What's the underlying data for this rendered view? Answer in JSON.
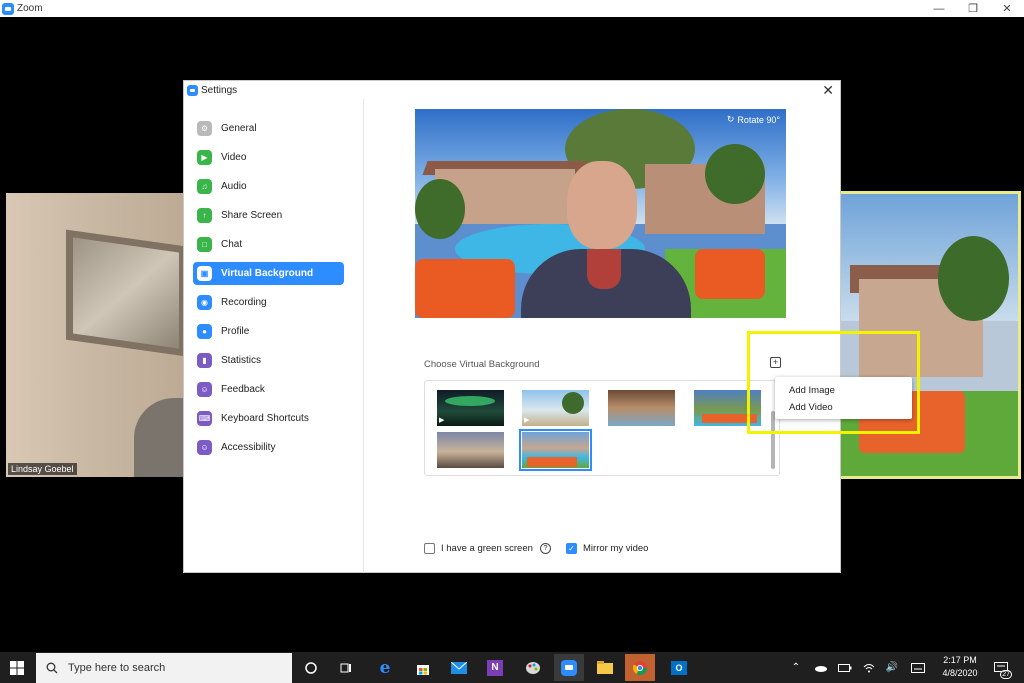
{
  "zoom_window": {
    "title": "Zoom",
    "controls": [
      "minimize",
      "restore",
      "close"
    ]
  },
  "participants": [
    {
      "name": "Lindsay Goebel"
    }
  ],
  "settings": {
    "title": "Settings",
    "close_glyph": "✕",
    "nav": [
      {
        "label": "General",
        "icon": "gear-icon",
        "color": "#b9b9b9"
      },
      {
        "label": "Video",
        "icon": "video-icon",
        "color": "#39b54a"
      },
      {
        "label": "Audio",
        "icon": "headphones-icon",
        "color": "#39b54a"
      },
      {
        "label": "Share Screen",
        "icon": "share-screen-icon",
        "color": "#39b54a"
      },
      {
        "label": "Chat",
        "icon": "chat-icon",
        "color": "#39b54a"
      },
      {
        "label": "Virtual Background",
        "icon": "virtual-background-icon",
        "color": "#2d8cff",
        "active": true
      },
      {
        "label": "Recording",
        "icon": "recording-icon",
        "color": "#2d8cff"
      },
      {
        "label": "Profile",
        "icon": "profile-icon",
        "color": "#2d8cff"
      },
      {
        "label": "Statistics",
        "icon": "statistics-icon",
        "color": "#7c5cc4"
      },
      {
        "label": "Feedback",
        "icon": "feedback-icon",
        "color": "#7c5cc4"
      },
      {
        "label": "Keyboard Shortcuts",
        "icon": "keyboard-icon",
        "color": "#7c5cc4"
      },
      {
        "label": "Accessibility",
        "icon": "accessibility-icon",
        "color": "#7c5cc4"
      }
    ],
    "preview": {
      "rotate_label": "Rotate 90°"
    },
    "choose_label": "Choose Virtual Background",
    "add_menu": {
      "add_image": "Add Image",
      "add_video": "Add Video"
    },
    "backgrounds": [
      {
        "name": "aurora",
        "video": true
      },
      {
        "name": "beach",
        "video": true
      },
      {
        "name": "interior"
      },
      {
        "name": "resort-pool"
      },
      {
        "name": "city-skyline"
      },
      {
        "name": "backyard-pool",
        "selected": true
      }
    ],
    "green_screen_label": "I have a green screen",
    "green_screen_checked": false,
    "mirror_label": "Mirror my video",
    "mirror_checked": true
  },
  "taskbar": {
    "search_placeholder": "Type here to search",
    "pinned": [
      "cortana-icon",
      "task-view-icon",
      "edge-icon",
      "store-icon",
      "mail-icon",
      "onenote-icon",
      "paint-icon",
      "zoom-icon",
      "file-explorer-icon",
      "chrome-icon",
      "outlook-icon"
    ],
    "time": "2:17 PM",
    "date": "4/8/2020",
    "notification_count": "27"
  },
  "colors": {
    "accent": "#2d8cff",
    "highlight": "#f3f300"
  }
}
